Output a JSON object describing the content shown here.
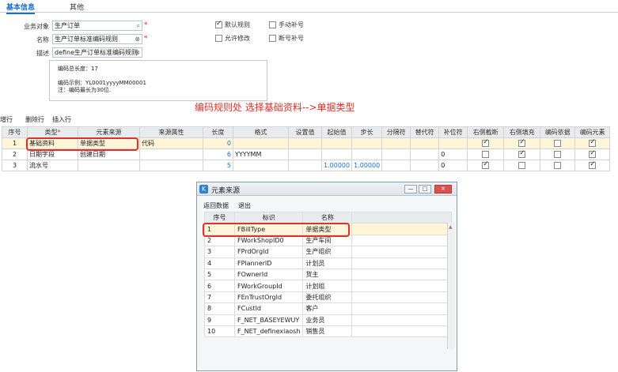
{
  "tabs": [
    {
      "label": "基本信息"
    },
    {
      "label": "其他"
    }
  ],
  "form": {
    "object_label": "业务对象",
    "object_value": "生产订单",
    "name_label": "名称",
    "name_value": "生产订单标准编码规则",
    "desc_label": "描述",
    "desc_value": "define生产订单标准编码规则",
    "required_mark": "*"
  },
  "options": {
    "default_rule": "默认规则",
    "manual_fill": "手动补号",
    "allow_modify": "允许修改",
    "auto_fill": "断号补号"
  },
  "info": {
    "total_length": "编码总长度：17",
    "example": "编码示例：YL0001yyyyMM00001",
    "note": "注：编码最长为30位."
  },
  "annotation": "编码规则处 选择基础资料-->单据类型",
  "toolbar": {
    "add": "新增行",
    "delete": "删除行",
    "insert": "插入行"
  },
  "grid": {
    "headers": [
      "序号",
      "类型",
      "元素来源",
      "来源属性",
      "长度",
      "格式",
      "设置值",
      "起始值",
      "步长",
      "分隔符",
      "替代符",
      "补位符",
      "右侧截断",
      "右侧填充",
      "编码依据",
      "编码元素"
    ],
    "rows": [
      {
        "seq": "1",
        "type": "基础资料",
        "src": "单据类型",
        "attr": "代码",
        "len": "0",
        "fmt": "",
        "set": "",
        "start": "",
        "step": "",
        "sep": "",
        "rep": "",
        "pad": "",
        "c1": true,
        "c2": true,
        "c3": false,
        "c4": true
      },
      {
        "seq": "2",
        "type": "日期字段",
        "src": "创建日期",
        "attr": "",
        "len": "6",
        "fmt": "YYYYMM",
        "set": "",
        "start": "",
        "step": "",
        "sep": "",
        "rep": "",
        "pad": "0",
        "c1": false,
        "c2": true,
        "c3": false,
        "c4": true
      },
      {
        "seq": "3",
        "type": "流水号",
        "src": "",
        "attr": "",
        "len": "5",
        "fmt": "",
        "set": "",
        "start": "1.00000",
        "step": "1.00000",
        "sep": "",
        "rep": "",
        "pad": "0",
        "c1": true,
        "c2": false,
        "c3": false,
        "c4": true
      }
    ]
  },
  "dialog": {
    "title": "元素来源",
    "return_data": "返回数据",
    "exit": "退出",
    "headers": [
      "序号",
      "标识",
      "名称"
    ],
    "rows": [
      {
        "seq": "1",
        "id": "FBillType",
        "name": "单据类型"
      },
      {
        "seq": "2",
        "id": "FWorkShopID0",
        "name": "生产车间"
      },
      {
        "seq": "3",
        "id": "FPrdOrgId",
        "name": "生产组织"
      },
      {
        "seq": "4",
        "id": "FPlannerID",
        "name": "计划员"
      },
      {
        "seq": "5",
        "id": "FOwnerId",
        "name": "货主"
      },
      {
        "seq": "6",
        "id": "FWorkGroupId",
        "name": "计划组"
      },
      {
        "seq": "7",
        "id": "FEnTrustOrgId",
        "name": "委托组织"
      },
      {
        "seq": "8",
        "id": "FCustId",
        "name": "客户"
      },
      {
        "seq": "9",
        "id": "F_NET_BASEYEWUY",
        "name": "业务员"
      },
      {
        "seq": "10",
        "id": "F_NET_definexiaosh",
        "name": "销售员"
      }
    ]
  }
}
